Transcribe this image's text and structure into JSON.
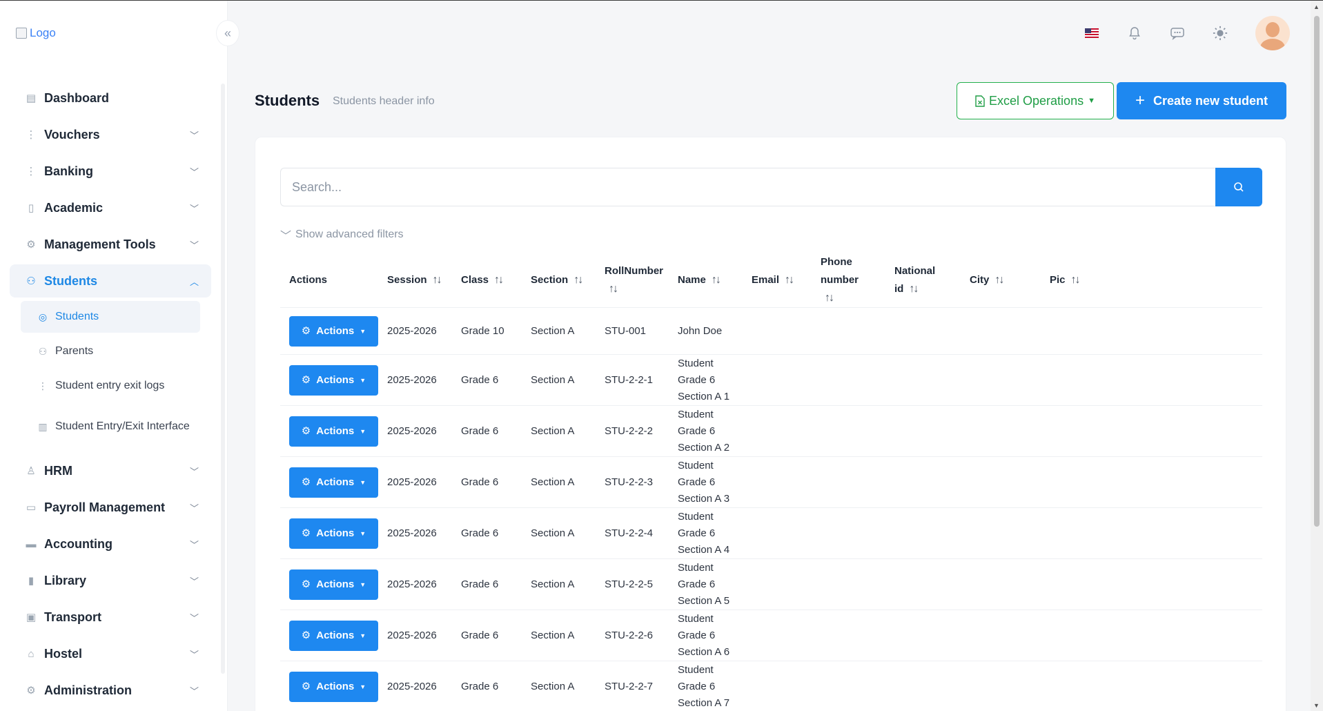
{
  "logo_alt": "Logo",
  "nav": {
    "dashboard": "Dashboard",
    "vouchers": "Vouchers",
    "banking": "Banking",
    "academic": "Academic",
    "management_tools": "Management Tools",
    "students": "Students",
    "students_sub": {
      "students": "Students",
      "parents": "Parents",
      "entry_exit_logs": "Student entry exit logs",
      "entry_exit_interface": "Student Entry/Exit Interface"
    },
    "hrm": "HRM",
    "payroll": "Payroll Management",
    "accounting": "Accounting",
    "library": "Library",
    "transport": "Transport",
    "hostel": "Hostel",
    "administration": "Administration"
  },
  "page": {
    "title": "Students",
    "subtitle": "Students header info",
    "excel_label": "Excel Operations",
    "create_label": "Create new student"
  },
  "search": {
    "placeholder": "Search...",
    "advanced_filters": "Show advanced filters"
  },
  "table": {
    "headers": {
      "actions": "Actions",
      "session": "Session",
      "class": "Class",
      "section": "Section",
      "roll": "RollNumber",
      "name": "Name",
      "email": "Email",
      "phone": "Phone number",
      "national_id": "National id",
      "city": "City",
      "pic": "Pic"
    },
    "action_label": "Actions",
    "rows": [
      {
        "session": "2025-2026",
        "class": "Grade 10",
        "section": "Section A",
        "roll": "STU-001",
        "name": "John Doe"
      },
      {
        "session": "2025-2026",
        "class": "Grade 6",
        "section": "Section A",
        "roll": "STU-2-2-1",
        "name": "Student Grade 6 Section A 1"
      },
      {
        "session": "2025-2026",
        "class": "Grade 6",
        "section": "Section A",
        "roll": "STU-2-2-2",
        "name": "Student Grade 6 Section A 2"
      },
      {
        "session": "2025-2026",
        "class": "Grade 6",
        "section": "Section A",
        "roll": "STU-2-2-3",
        "name": "Student Grade 6 Section A 3"
      },
      {
        "session": "2025-2026",
        "class": "Grade 6",
        "section": "Section A",
        "roll": "STU-2-2-4",
        "name": "Student Grade 6 Section A 4"
      },
      {
        "session": "2025-2026",
        "class": "Grade 6",
        "section": "Section A",
        "roll": "STU-2-2-5",
        "name": "Student Grade 6 Section A 5"
      },
      {
        "session": "2025-2026",
        "class": "Grade 6",
        "section": "Section A",
        "roll": "STU-2-2-6",
        "name": "Student Grade 6 Section A 6"
      },
      {
        "session": "2025-2026",
        "class": "Grade 6",
        "section": "Section A",
        "roll": "STU-2-2-7",
        "name": "Student Grade 6 Section A 7"
      }
    ]
  },
  "colors": {
    "primary": "#1e88f0",
    "excel_green": "#22b04b",
    "active_bg": "#f1f4f9"
  }
}
